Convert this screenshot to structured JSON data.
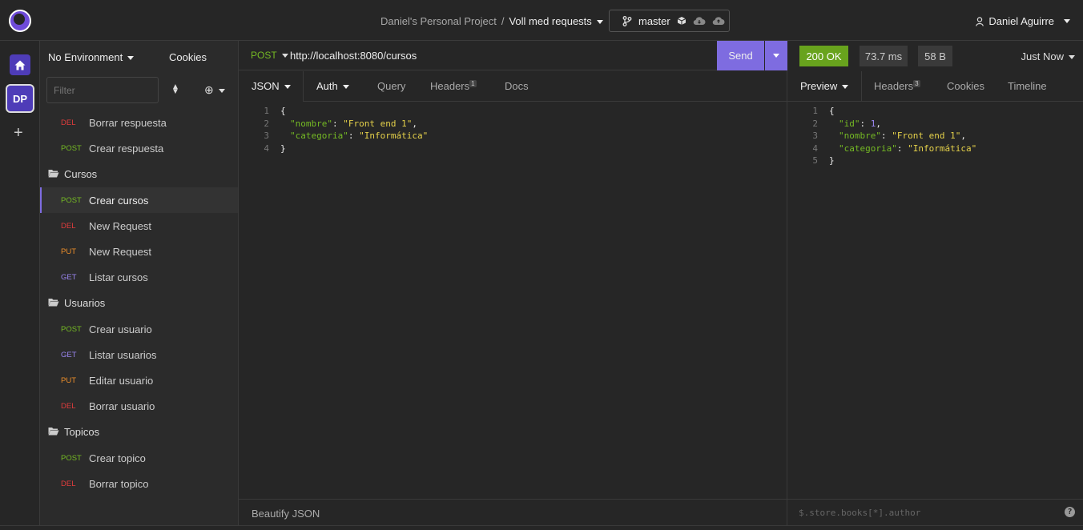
{
  "topbar": {
    "project": "Daniel's Personal Project",
    "separator": "/",
    "collection": "Voll med requests",
    "branch": "master",
    "user": "Daniel Aguirre"
  },
  "rail": {
    "workspace_initials": "DP",
    "add_symbol": "+"
  },
  "sidebar": {
    "environment": "No Environment",
    "cookies": "Cookies",
    "filter_placeholder": "Filter",
    "items": [
      {
        "type": "request",
        "method": "DEL",
        "label": "Borrar respuesta"
      },
      {
        "type": "request",
        "method": "POST",
        "label": "Crear respuesta"
      },
      {
        "type": "folder",
        "label": "Cursos"
      },
      {
        "type": "request",
        "method": "POST",
        "label": "Crear cursos",
        "active": true
      },
      {
        "type": "request",
        "method": "DEL",
        "label": "New Request"
      },
      {
        "type": "request",
        "method": "PUT",
        "label": "New Request"
      },
      {
        "type": "request",
        "method": "GET",
        "label": "Listar cursos"
      },
      {
        "type": "folder",
        "label": "Usuarios"
      },
      {
        "type": "request",
        "method": "POST",
        "label": "Crear usuario"
      },
      {
        "type": "request",
        "method": "GET",
        "label": "Listar usuarios"
      },
      {
        "type": "request",
        "method": "PUT",
        "label": "Editar usuario"
      },
      {
        "type": "request",
        "method": "DEL",
        "label": "Borrar usuario"
      },
      {
        "type": "folder",
        "label": "Topicos"
      },
      {
        "type": "request",
        "method": "POST",
        "label": "Crear topico"
      },
      {
        "type": "request",
        "method": "DEL",
        "label": "Borrar topico"
      }
    ]
  },
  "request": {
    "method": "POST",
    "url": "http://localhost:8080/cursos",
    "send_label": "Send",
    "tabs": {
      "json": "JSON",
      "auth": "Auth",
      "query": "Query",
      "headers": "Headers",
      "headers_count": "1",
      "docs": "Docs"
    },
    "body_lines": [
      {
        "n": "1",
        "text": "{"
      },
      {
        "n": "2",
        "key": "\"nombre\"",
        "value": "\"Front end 1\"",
        "trail": ","
      },
      {
        "n": "3",
        "key": "\"categoria\"",
        "value": "\"Informática\"",
        "trail": ""
      },
      {
        "n": "4",
        "text": "}"
      }
    ],
    "footer": "Beautify JSON"
  },
  "response": {
    "status": "200 OK",
    "time": "73.7 ms",
    "size": "58 B",
    "history": "Just Now",
    "tabs": {
      "preview": "Preview",
      "headers": "Headers",
      "headers_count": "3",
      "cookies": "Cookies",
      "timeline": "Timeline"
    },
    "filter_placeholder": "$.store.books[*].author",
    "help": "?"
  },
  "colors": {
    "accent": "#7e6ce0",
    "ok": "#68a31d",
    "post": "#75ba24",
    "del": "#e03c3c",
    "put": "#ef8f2a",
    "get": "#9a86f0"
  }
}
